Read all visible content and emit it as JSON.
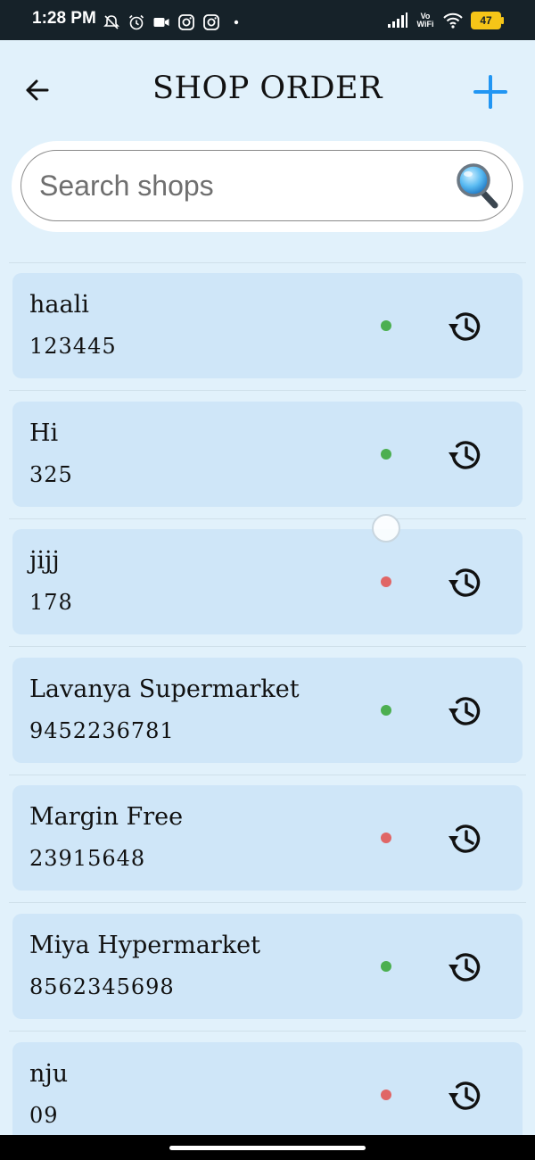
{
  "status_bar": {
    "time": "1:28 PM",
    "icons_left": [
      "bell-off-icon",
      "alarm-icon",
      "video-camera-icon",
      "instagram-icon",
      "instagram-icon",
      "dot-icon"
    ],
    "vowifi_line1": "Vo",
    "vowifi_line2": "WiFi",
    "battery": "47",
    "battery_color": "#f5c518"
  },
  "header": {
    "title": "SHOP ORDER",
    "back_icon": "arrow-left-icon",
    "add_icon": "plus-icon",
    "add_color": "#2196f3"
  },
  "search": {
    "placeholder": "Search shops",
    "value": "",
    "icon": "magnifier-icon"
  },
  "colors": {
    "active": "#4caf50",
    "inactive": "#e06666",
    "card": "#cfe6f8",
    "background": "#e1f1fb"
  },
  "shops": [
    {
      "name": "haali",
      "phone": "123445",
      "status": "active"
    },
    {
      "name": "Hi",
      "phone": "325",
      "status": "active"
    },
    {
      "name": "jijj",
      "phone": "178",
      "status": "inactive"
    },
    {
      "name": "Lavanya Supermarket",
      "phone": "9452236781",
      "status": "active"
    },
    {
      "name": "Margin Free",
      "phone": "23915648",
      "status": "inactive"
    },
    {
      "name": "Miya Hypermarket",
      "phone": "8562345698",
      "status": "active"
    },
    {
      "name": "nju",
      "phone": "09",
      "status": "inactive"
    }
  ]
}
